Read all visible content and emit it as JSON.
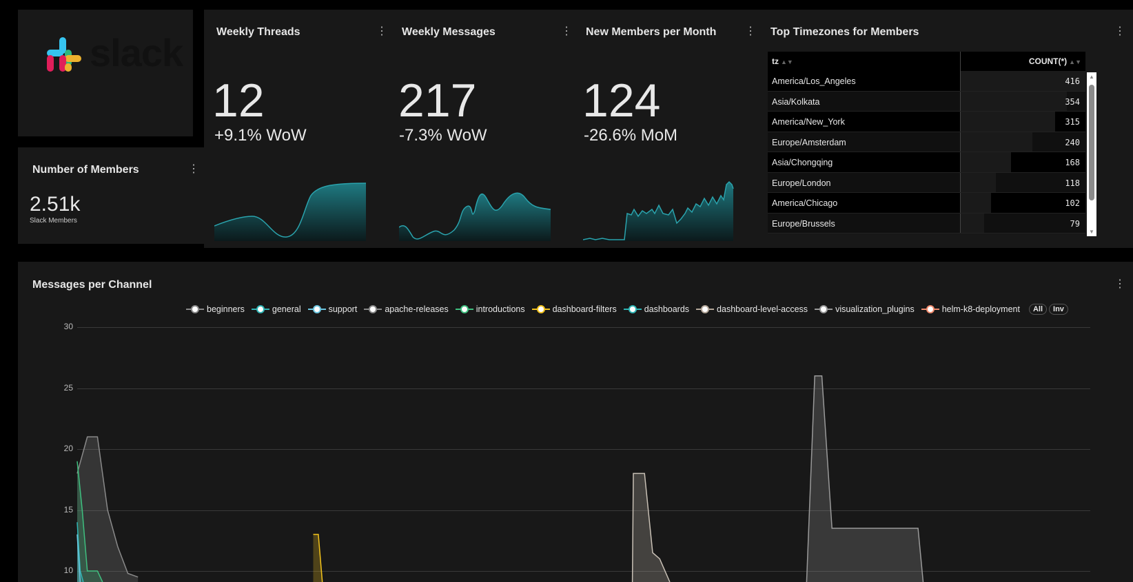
{
  "logo": {
    "text": "slack"
  },
  "members": {
    "title": "Number of Members",
    "value": "2.51k",
    "subtitle": "Slack Members"
  },
  "kpis": [
    {
      "title": "Weekly Threads",
      "value": "12",
      "delta": "+9.1% WoW"
    },
    {
      "title": "Weekly Messages",
      "value": "217",
      "delta": "-7.3% WoW"
    },
    {
      "title": "New Members per Month",
      "value": "124",
      "delta": "-26.6% MoM"
    }
  ],
  "timezones": {
    "title": "Top Timezones for Members",
    "columns": [
      "tz",
      "COUNT(*)"
    ],
    "rows": [
      {
        "tz": "America/Los_Angeles",
        "count": 416
      },
      {
        "tz": "Asia/Kolkata",
        "count": 354
      },
      {
        "tz": "America/New_York",
        "count": 315
      },
      {
        "tz": "Europe/Amsterdam",
        "count": 240
      },
      {
        "tz": "Asia/Chongqing",
        "count": 168
      },
      {
        "tz": "Europe/London",
        "count": 118
      },
      {
        "tz": "America/Chicago",
        "count": 102
      },
      {
        "tz": "Europe/Brussels",
        "count": 79
      }
    ]
  },
  "channels": {
    "title": "Messages per Channel",
    "legend": [
      {
        "name": "beginners",
        "color": "#8a8a8a"
      },
      {
        "name": "general",
        "color": "#2fb5b5"
      },
      {
        "name": "support",
        "color": "#6cc6e0"
      },
      {
        "name": "apache-releases",
        "color": "#8a8a8a"
      },
      {
        "name": "introductions",
        "color": "#3fbf7f"
      },
      {
        "name": "dashboard-filters",
        "color": "#f2c21b"
      },
      {
        "name": "dashboards",
        "color": "#2fb5b5"
      },
      {
        "name": "dashboard-level-access",
        "color": "#b5a89a"
      },
      {
        "name": "visualization_plugins",
        "color": "#9a9a9a"
      },
      {
        "name": "helm-k8-deployment",
        "color": "#f08a6c"
      }
    ],
    "all_label": "All",
    "inv_label": "Inv"
  },
  "chart_data": {
    "type": "area",
    "title": "Messages per Channel",
    "yticks": [
      10,
      15,
      20,
      25,
      30
    ],
    "ylim": [
      10,
      30
    ],
    "grid": true,
    "legend_placement": "top",
    "series": [
      {
        "name": "beginners",
        "color": "#8a8a8a",
        "peaks": [
          [
            0.0,
            18
          ],
          [
            0.01,
            21
          ],
          [
            0.02,
            21
          ],
          [
            0.03,
            15
          ],
          [
            0.04,
            12
          ],
          [
            0.05,
            9.8
          ],
          [
            0.06,
            9.5
          ]
        ]
      },
      {
        "name": "introductions",
        "color": "#3fbf7f",
        "peaks": [
          [
            0.0,
            19
          ],
          [
            0.005,
            15
          ],
          [
            0.01,
            10
          ],
          [
            0.02,
            10
          ],
          [
            0.025,
            9
          ]
        ]
      },
      {
        "name": "general",
        "color": "#2fb5b5",
        "peaks": [
          [
            0.0,
            14
          ],
          [
            0.003,
            10
          ],
          [
            0.006,
            9
          ]
        ]
      },
      {
        "name": "support",
        "color": "#6cc6e0",
        "peaks": [
          [
            0.0,
            13
          ],
          [
            0.003,
            9
          ]
        ]
      },
      {
        "name": "dashboard-filters",
        "color": "#f2c21b",
        "peaks": [
          [
            0.233,
            13
          ],
          [
            0.238,
            13
          ],
          [
            0.242,
            9
          ]
        ]
      },
      {
        "name": "dashboard-level-access",
        "color": "#c8c0b5",
        "peaks": [
          [
            0.548,
            9
          ],
          [
            0.549,
            18
          ],
          [
            0.56,
            18
          ],
          [
            0.568,
            11.5
          ],
          [
            0.575,
            11
          ],
          [
            0.585,
            9
          ]
        ]
      },
      {
        "name": "visualization_plugins",
        "color": "#9a9a9a",
        "peaks": [
          [
            0.72,
            9
          ],
          [
            0.728,
            26
          ],
          [
            0.735,
            26
          ],
          [
            0.745,
            13.5
          ],
          [
            0.83,
            13.5
          ],
          [
            0.835,
            9
          ]
        ]
      }
    ]
  }
}
